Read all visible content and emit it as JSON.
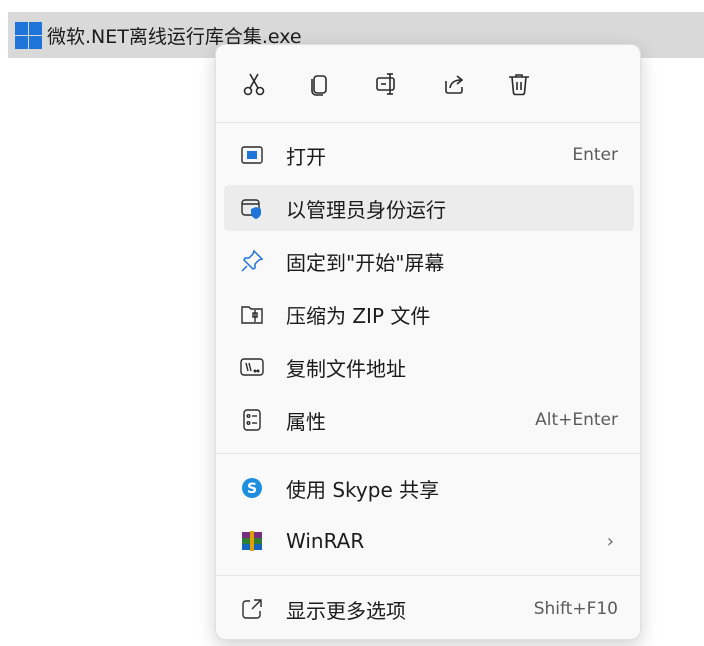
{
  "file": {
    "name": "微软.NET离线运行库合集.exe"
  },
  "quick_actions": [
    {
      "name": "cut",
      "icon": "scissors-icon"
    },
    {
      "name": "copy",
      "icon": "copy-icon"
    },
    {
      "name": "rename",
      "icon": "rename-icon"
    },
    {
      "name": "share",
      "icon": "share-icon"
    },
    {
      "name": "delete",
      "icon": "trash-icon"
    }
  ],
  "menu": {
    "items": [
      {
        "label": "打开",
        "shortcut": "Enter",
        "icon": "open-window-icon"
      },
      {
        "label": "以管理员身份运行",
        "shortcut": "",
        "icon": "admin-shield-icon"
      },
      {
        "label": "固定到\"开始\"屏幕",
        "shortcut": "",
        "icon": "pin-icon"
      },
      {
        "label": "压缩为 ZIP 文件",
        "shortcut": "",
        "icon": "zip-folder-icon"
      },
      {
        "label": "复制文件地址",
        "shortcut": "",
        "icon": "copy-path-icon"
      },
      {
        "label": "属性",
        "shortcut": "Alt+Enter",
        "icon": "properties-icon"
      },
      {
        "label": "使用 Skype 共享",
        "shortcut": "",
        "icon": "skype-icon"
      },
      {
        "label": "WinRAR",
        "shortcut": "",
        "icon": "winrar-icon",
        "submenu": "›"
      },
      {
        "label": "显示更多选项",
        "shortcut": "Shift+F10",
        "icon": "show-more-options-icon"
      }
    ]
  },
  "colors": {
    "accent": "#1e74d8",
    "menu_bg": "#f9f9f9",
    "hover_bg": "#ececec",
    "selected_bar": "#d9d9d9"
  }
}
